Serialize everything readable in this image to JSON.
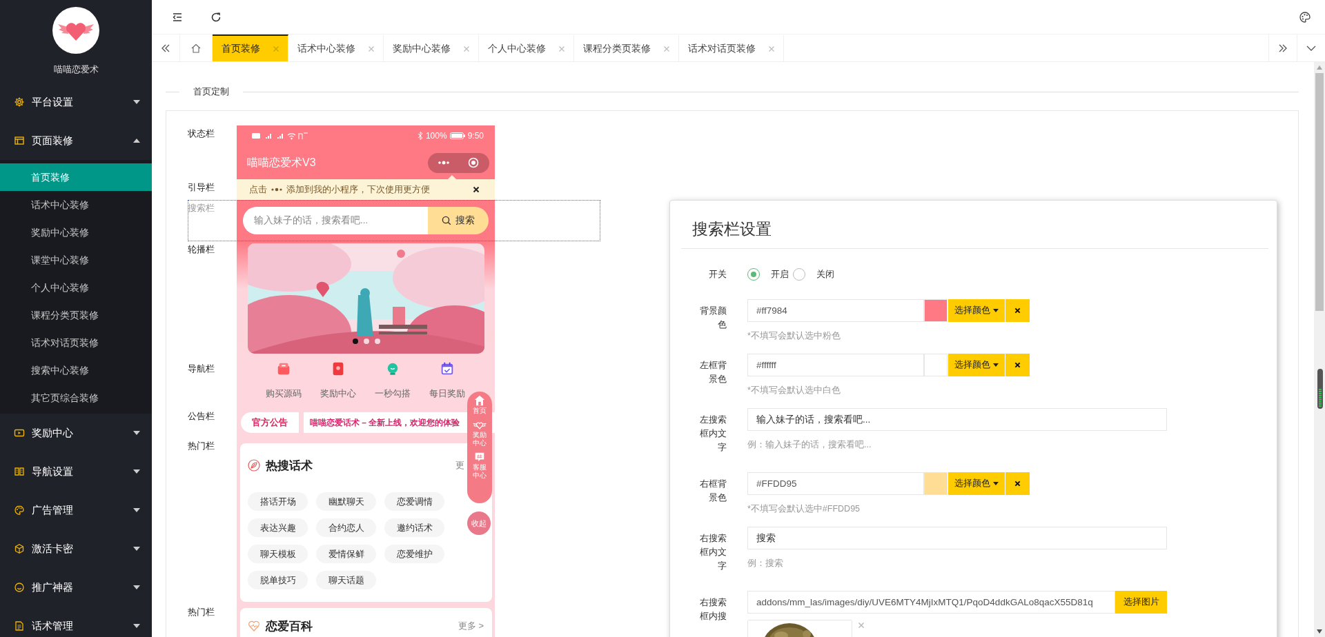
{
  "sidebar": {
    "brand": "喵喵恋爱术",
    "menu": [
      {
        "label": "平台设置",
        "expanded": false
      },
      {
        "label": "页面装修",
        "expanded": true,
        "children": [
          {
            "label": "首页装修",
            "selected": true
          },
          {
            "label": "话术中心装修",
            "selected": false
          },
          {
            "label": "奖励中心装修",
            "selected": false
          },
          {
            "label": "课堂中心装修",
            "selected": false
          },
          {
            "label": "个人中心装修",
            "selected": false
          },
          {
            "label": "课程分类页装修",
            "selected": false
          },
          {
            "label": "话术对话页装修",
            "selected": false
          },
          {
            "label": "搜索中心装修",
            "selected": false
          },
          {
            "label": "其它页综合装修",
            "selected": false
          }
        ]
      },
      {
        "label": "奖励中心",
        "expanded": false
      },
      {
        "label": "导航设置",
        "expanded": false
      },
      {
        "label": "广告管理",
        "expanded": false
      },
      {
        "label": "激活卡密",
        "expanded": false
      },
      {
        "label": "推广神器",
        "expanded": false
      },
      {
        "label": "话术管理",
        "expanded": false
      }
    ]
  },
  "tabs": [
    {
      "label": "首页装修",
      "selected": true
    },
    {
      "label": "话术中心装修",
      "selected": false
    },
    {
      "label": "奖励中心装修",
      "selected": false
    },
    {
      "label": "个人中心装修",
      "selected": false
    },
    {
      "label": "课程分类页装修",
      "selected": false
    },
    {
      "label": "话术对话页装修",
      "selected": false
    }
  ],
  "section_title": "首页定制",
  "preview": {
    "sections": [
      {
        "label": "状态栏",
        "kind": "header",
        "battery": "100%",
        "time": "9:50",
        "title": "喵喵恋爱术V3"
      },
      {
        "label": "引导栏",
        "kind": "guide",
        "prefix": "点击",
        "text": "添加到我的小程序，下次使用更方便"
      },
      {
        "label": "搜索栏",
        "kind": "search",
        "focused": true,
        "placeholder": "输入妹子的话，搜索看吧...",
        "button": "搜索"
      },
      {
        "label": "轮播栏",
        "kind": "carousel",
        "dots": [
          {
            "selected": true
          },
          {
            "selected": false
          },
          {
            "selected": false
          }
        ]
      },
      {
        "label": "导航栏",
        "kind": "nav",
        "items": [
          "购买源码",
          "奖励中心",
          "一秒勾搭",
          "每日奖励"
        ]
      },
      {
        "label": "公告栏",
        "kind": "notice",
        "tag": "官方公告",
        "text": "喵喵恋爱话术 – 全新上线，欢迎您的体验"
      },
      {
        "label": "热门栏",
        "kind": "hot",
        "title": "热搜话术",
        "more": "更",
        "tags": [
          "搭话开场",
          "幽默聊天",
          "恋爱调情",
          "表达兴趣",
          "合约恋人",
          "邀约话术",
          "聊天模板",
          "爱情保鲜",
          "恋爱维护",
          "脱单技巧",
          "聊天话题"
        ]
      },
      {
        "label": "热门栏",
        "kind": "wiki",
        "title": "恋爱百科",
        "more": "更多 >"
      }
    ],
    "float_menu": {
      "items": [
        "首页",
        "奖励中心",
        "客服中心"
      ],
      "collapse": "收起"
    }
  },
  "panel": {
    "title": "搜索栏设置",
    "fields": [
      {
        "kind": "radio",
        "label": "开关",
        "options": [
          {
            "label": "开启",
            "selected": true
          },
          {
            "label": "关闭",
            "selected": false
          }
        ]
      },
      {
        "kind": "color",
        "label": "背景颜色",
        "value": "#ff7984",
        "color": "#ff7984",
        "button": "选择颜色",
        "hint": "*不填写会默认选中粉色"
      },
      {
        "kind": "color",
        "label": "左框背景色",
        "value": "#ffffff",
        "color": "#ffffff",
        "button": "选择颜色",
        "hint": "*不填写会默认选中白色"
      },
      {
        "kind": "text",
        "label": "左搜索框内文字",
        "value": "输入妹子的话，搜索看吧...",
        "hint": "例：输入妹子的话，搜索看吧..."
      },
      {
        "kind": "color",
        "label": "右框背景色",
        "value": "#FFDD95",
        "color": "#ffdd95",
        "button": "选择颜色",
        "hint": "*不填写会默认选中#FFDD95"
      },
      {
        "kind": "text",
        "label": "右搜索框内文字",
        "value": "搜索",
        "hint": "例：搜索"
      },
      {
        "label": "右搜索框内搜",
        "value": "addons/mm_las/images/diy/UVE6MTY4MjIxMTQ1/PqoD4ddkGALo8qacX55D81q",
        "button": "选择图片"
      }
    ]
  }
}
